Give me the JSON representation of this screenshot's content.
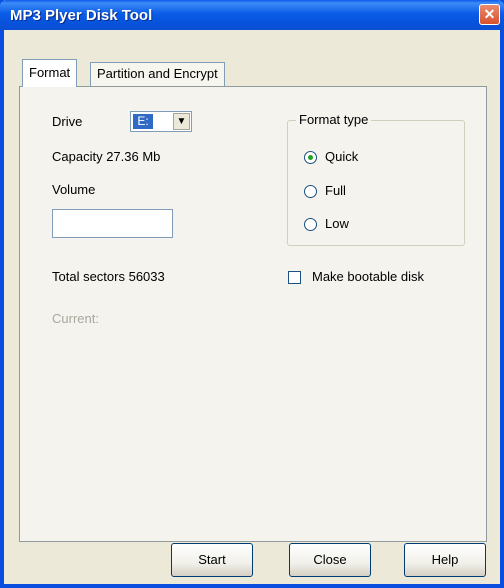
{
  "window": {
    "title": "MP3 Plyer Disk Tool",
    "close_glyph": "✕"
  },
  "tabs": [
    {
      "label": "Format",
      "active": true
    },
    {
      "label": "Partition and Encrypt",
      "active": false
    }
  ],
  "format": {
    "drive_label": "Drive",
    "drive_value": "E:",
    "capacity_text": "Capacity 27.36 Mb",
    "volume_label": "Volume",
    "volume_value": "",
    "total_sectors_text": "Total sectors 56033",
    "current_label": "Current:",
    "format_type": {
      "legend": "Format type",
      "options": [
        {
          "label": "Quick",
          "selected": true
        },
        {
          "label": "Full",
          "selected": false
        },
        {
          "label": "Low",
          "selected": false
        }
      ]
    },
    "bootable_label": "Make bootable disk",
    "bootable_checked": false
  },
  "buttons": {
    "start": "Start",
    "close": "Close",
    "help": "Help"
  },
  "colors": {
    "titlebar": "#0a58ea",
    "window_bg": "#ece9d8",
    "selection": "#316ac5",
    "disabled_text": "#a9a89d"
  },
  "icons": {
    "close": "close-icon",
    "dropdown": "chevron-down-icon"
  }
}
